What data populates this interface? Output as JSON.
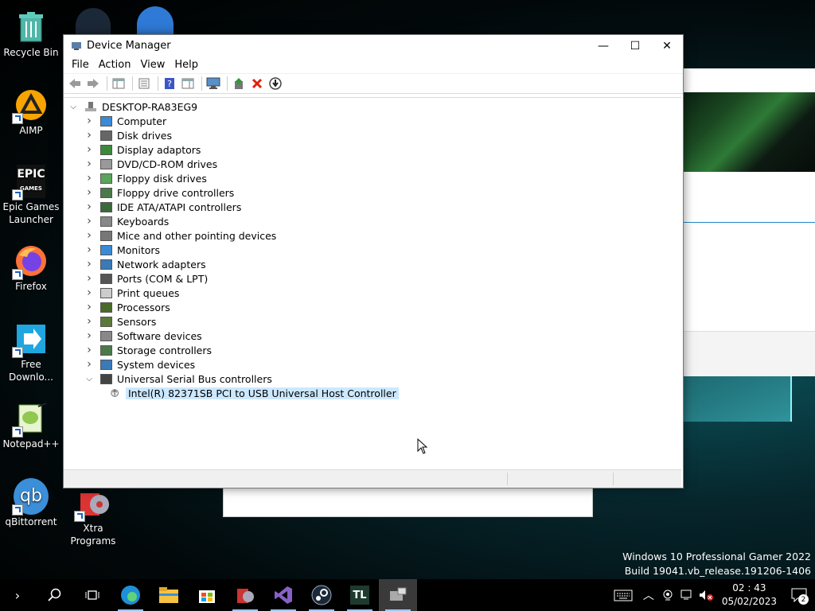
{
  "desktop": {
    "icons": [
      {
        "label": "Recycle Bin"
      },
      {
        "label": "AIMP"
      },
      {
        "label": "Epic Games Launcher"
      },
      {
        "label": "Firefox"
      },
      {
        "label": "Free Downlo..."
      },
      {
        "label": "Notepad++"
      },
      {
        "label": "qBittorrent"
      },
      {
        "label": "Xtra Programs"
      }
    ],
    "epic_logo_text": "EPIC",
    "epic_logo_sub": "GAMES",
    "qb_logo_text": "qb"
  },
  "window": {
    "title": "Device Manager",
    "controls": {
      "minimize": "—",
      "maximize": "☐",
      "close": "✕"
    },
    "menu": [
      "File",
      "Action",
      "View",
      "Help"
    ],
    "tree": {
      "root": "DESKTOP-RA83EG9",
      "categories": [
        {
          "label": "Computer",
          "icon": "computer-icon",
          "expanded": false
        },
        {
          "label": "Disk drives",
          "icon": "disk-drive-icon",
          "expanded": false
        },
        {
          "label": "Display adaptors",
          "icon": "display-adapter-icon",
          "expanded": false
        },
        {
          "label": "DVD/CD-ROM drives",
          "icon": "dvd-icon",
          "expanded": false
        },
        {
          "label": "Floppy disk drives",
          "icon": "floppy-disk-icon",
          "expanded": false
        },
        {
          "label": "Floppy drive controllers",
          "icon": "floppy-controller-icon",
          "expanded": false
        },
        {
          "label": "IDE ATA/ATAPI controllers",
          "icon": "ide-controller-icon",
          "expanded": false
        },
        {
          "label": "Keyboards",
          "icon": "keyboard-icon",
          "expanded": false
        },
        {
          "label": "Mice and other pointing devices",
          "icon": "mouse-icon",
          "expanded": false
        },
        {
          "label": "Monitors",
          "icon": "monitor-icon",
          "expanded": false
        },
        {
          "label": "Network adapters",
          "icon": "network-adapter-icon",
          "expanded": false
        },
        {
          "label": "Ports (COM & LPT)",
          "icon": "port-icon",
          "expanded": false
        },
        {
          "label": "Print queues",
          "icon": "printer-icon",
          "expanded": false
        },
        {
          "label": "Processors",
          "icon": "processor-icon",
          "expanded": false
        },
        {
          "label": "Sensors",
          "icon": "sensor-icon",
          "expanded": false
        },
        {
          "label": "Software devices",
          "icon": "software-device-icon",
          "expanded": false
        },
        {
          "label": "Storage controllers",
          "icon": "storage-controller-icon",
          "expanded": false
        },
        {
          "label": "System devices",
          "icon": "system-device-icon",
          "expanded": false
        },
        {
          "label": "Universal Serial Bus controllers",
          "icon": "usb-icon",
          "expanded": true
        }
      ],
      "usb_child": "Intel(R) 82371SB PCI to USB Universal Host Controller"
    }
  },
  "watermark": {
    "line1": "Windows 10 Professional Gamer 2022",
    "line2": "Build 19041.vb_release.191206-1406"
  },
  "taskbar": {
    "time": "02 : 43",
    "date": "05/02/2023",
    "notification_count": "2",
    "pinned": [
      "edge-icon",
      "file-explorer-icon",
      "store-icon",
      "xtra-programs-icon",
      "visual-studio-icon",
      "steam-icon",
      "tl-icon",
      "device-manager-icon"
    ],
    "tl_label": "TL"
  },
  "colors": {
    "selection": "#cce8ff",
    "accent": "#1e88c8"
  }
}
